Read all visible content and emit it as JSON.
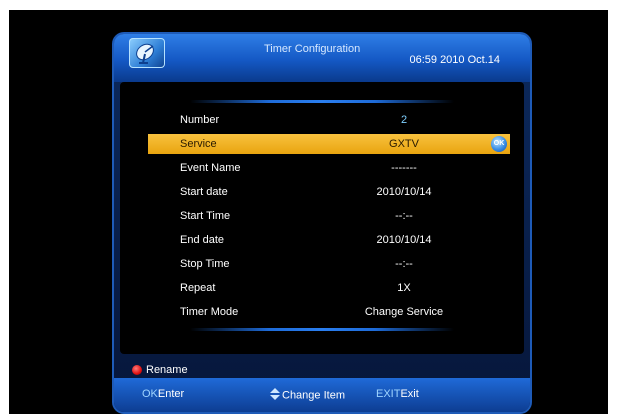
{
  "header": {
    "title": "Timer Configuration",
    "clock": "06:59  2010 Oct.14"
  },
  "rows": [
    {
      "label": "Number",
      "value": "2"
    },
    {
      "label": "Service",
      "value": "GXTV",
      "badge": "OK"
    },
    {
      "label": "Event Name",
      "value": "-------"
    },
    {
      "label": "Start date",
      "value": "2010/10/14"
    },
    {
      "label": "Start Time",
      "value": "--:--"
    },
    {
      "label": "End date",
      "value": "2010/10/14"
    },
    {
      "label": "Stop Time",
      "value": "--:--"
    },
    {
      "label": "Repeat",
      "value": "1X"
    },
    {
      "label": "Timer Mode",
      "value": "Change Service"
    }
  ],
  "rename": {
    "label": "Rename",
    "color": "#e01010"
  },
  "footer": {
    "ok_key": "OK",
    "ok_label": "Enter",
    "change_label": "Change Item",
    "exit_key": "EXIT",
    "exit_label": "Exit"
  },
  "colors": {
    "highlight": "#f2b52a",
    "accent": "#1e6bd8",
    "number_value": "#7fd0ff"
  },
  "icons": {
    "logo": "satellite-dish-icon",
    "ok": "ok-badge-icon",
    "rename": "red-button-icon",
    "change": "up-down-arrows-icon"
  }
}
